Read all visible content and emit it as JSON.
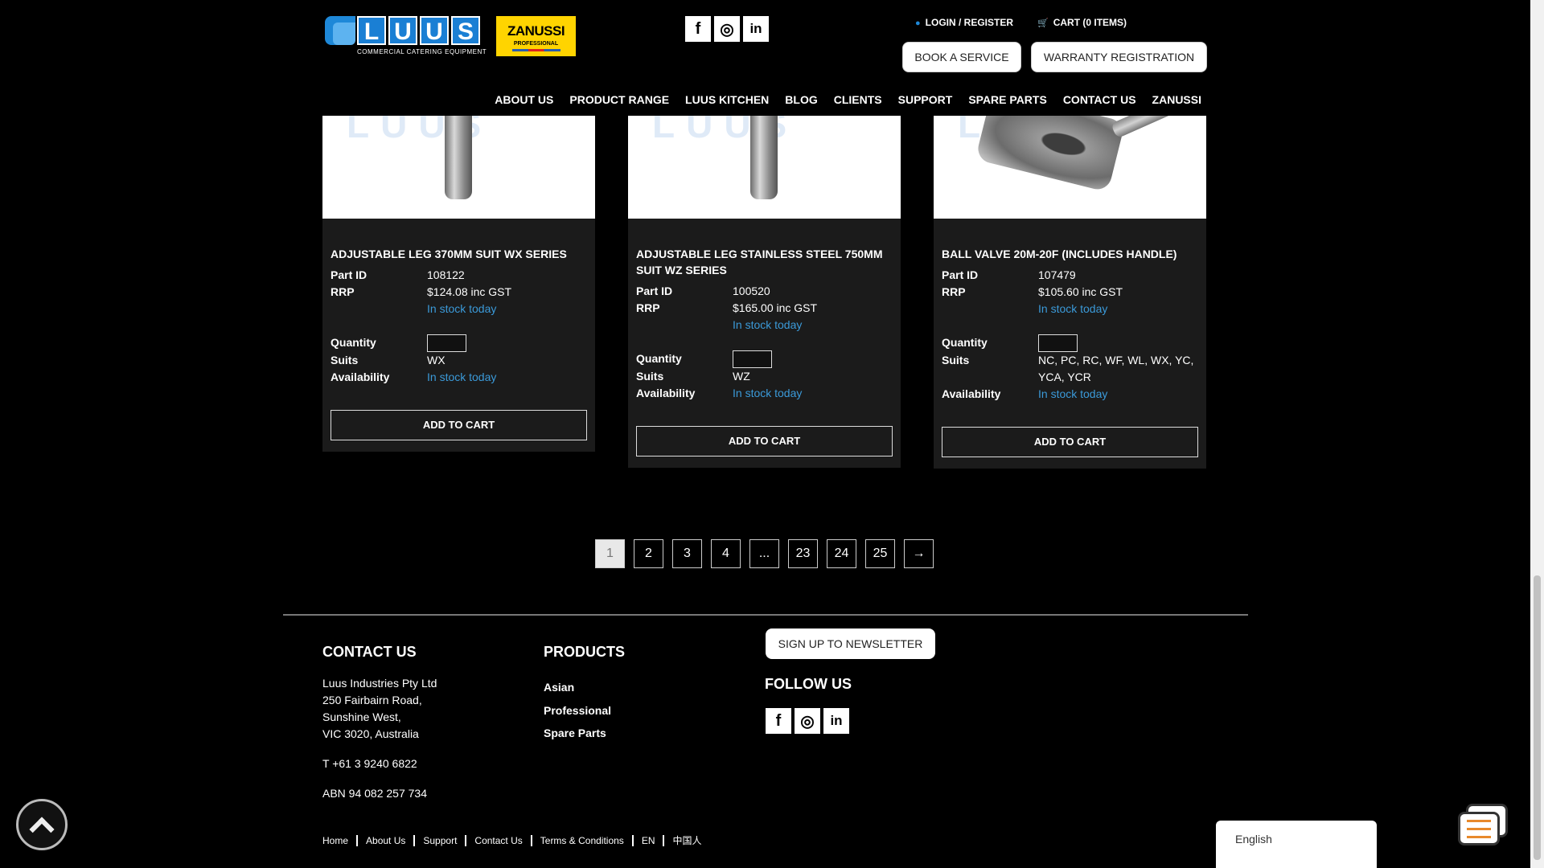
{
  "header": {
    "logo_letters": [
      "L",
      "U",
      "U",
      "S"
    ],
    "logo_tagline": "COMMERCIAL CATERING EQUIPMENT",
    "partner_logo": "ZANUSSI",
    "partner_logo_sub": "PROFESSIONAL",
    "social": [
      {
        "label": "f",
        "icon": "facebook-icon"
      },
      {
        "label": "◎",
        "icon": "instagram-icon"
      },
      {
        "label": "in",
        "icon": "linkedin-icon"
      }
    ],
    "login_label": "LOGIN / REGISTER",
    "cart_label": "CART (0 ITEMS)",
    "book_service": "BOOK A SERVICE",
    "warranty": "WARRANTY REGISTRATION",
    "nav": [
      "ABOUT US",
      "PRODUCT RANGE",
      "LUUS KITCHEN",
      "BLOG",
      "CLIENTS",
      "SUPPORT",
      "SPARE PARTS",
      "CONTACT US",
      "ZANUSSI"
    ]
  },
  "labels": {
    "part_id": "Part ID",
    "rrp": "RRP",
    "quantity": "Quantity",
    "suits": "Suits",
    "availability": "Availability",
    "add_to_cart": "ADD TO CART"
  },
  "products": [
    {
      "title": "ADJUSTABLE LEG 370MM SUIT WX SERIES",
      "part_id": "108122",
      "rrp": "$124.08 inc GST",
      "rrp_stock": "In stock today",
      "suits": "WX",
      "availability": "In stock today"
    },
    {
      "title": "ADJUSTABLE LEG STAINLESS STEEL 750MM SUIT WZ SERIES",
      "part_id": "100520",
      "rrp": "$165.00 inc GST",
      "rrp_stock": "In stock today",
      "suits": "WZ",
      "availability": "In stock today"
    },
    {
      "title": "BALL VALVE 20M-20F (INCLUDES HANDLE)",
      "part_id": "107479",
      "rrp": "$105.60 inc GST",
      "rrp_stock": "In stock today",
      "suits": "NC, PC, RC, WF, WL, WX, YC, YCA, YCR",
      "availability": "In stock today"
    }
  ],
  "pagination": {
    "pages": [
      "1",
      "2",
      "3",
      "4",
      "...",
      "23",
      "24",
      "25",
      "→"
    ],
    "current": "1"
  },
  "footer": {
    "contact_heading": "CONTACT US",
    "address_lines": [
      "Luus Industries Pty Ltd",
      "250 Fairbairn Road,",
      "Sunshine West,",
      "VIC 3020, Australia"
    ],
    "phone": "T +61 3 9240 6822",
    "abn": "ABN 94 082 257 734",
    "products_heading": "PRODUCTS",
    "products": [
      "Asian",
      "Professional",
      "Spare Parts"
    ],
    "newsletter": "SIGN UP TO NEWSLETTER",
    "follow_heading": "FOLLOW US",
    "bottom_links": [
      "Home",
      "About Us",
      "Support",
      "Contact Us",
      "Terms & Conditions",
      "EN",
      "中国人"
    ],
    "language": "English"
  },
  "colors": {
    "accent_blue": "#3b9ad9",
    "zanussi_yellow": "#ffd400",
    "chat_orange": "#e8892b"
  }
}
